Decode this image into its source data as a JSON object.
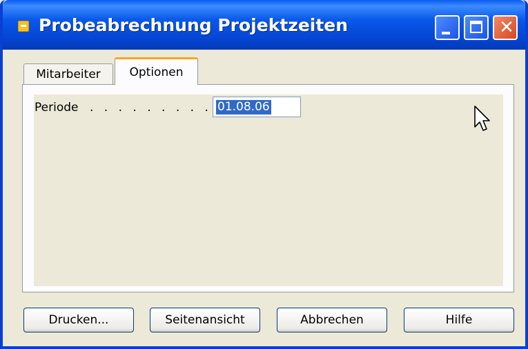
{
  "window": {
    "title": "Probeabrechnung Projektzeiten",
    "controls": {
      "minimize_icon": "minimize-icon",
      "maximize_icon": "maximize-icon",
      "close_icon": "close-icon",
      "close_glyph": "✕"
    }
  },
  "tabs": [
    {
      "label": "Mitarbeiter",
      "active": false
    },
    {
      "label": "Optionen",
      "active": true
    }
  ],
  "options": {
    "periode_label": "Periode",
    "periode_dots": ". . . . . . . . .",
    "periode_value": "01.08.06"
  },
  "buttons": {
    "print": "Drucken...",
    "preview": "Seitenansicht",
    "cancel": "Abbrechen",
    "help": "Hilfe"
  },
  "colors": {
    "titlebar": "#0a5cf0",
    "selection": "#316ac5",
    "active_tab_accent": "#f5a623",
    "dialog_bg": "#ece9d8"
  }
}
